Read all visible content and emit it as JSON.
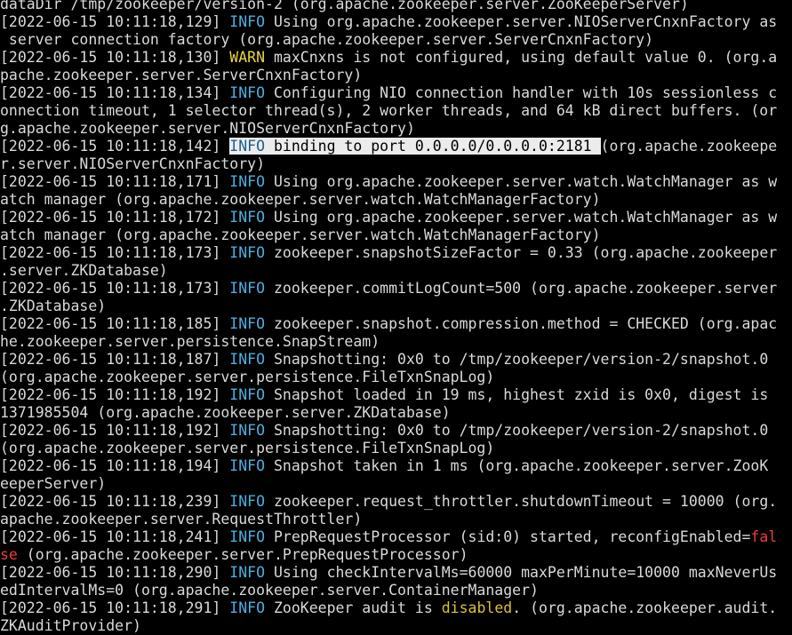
{
  "colors": {
    "background": "#000000",
    "text": "#d9d9d9",
    "info": "#49b0e0",
    "warn": "#e8d53a",
    "keyword_red": "#ef3b3b",
    "keyword_yellow": "#d6c332",
    "selection": "#ececec"
  },
  "terminal_lines": [
    [
      {
        "t": "dataDir /tmp/zookeeper/version-2 (org.apache.zookeeper.server.ZooKeeperServer)"
      }
    ],
    [
      {
        "t": "[2022-06-15 10:11:18,129] "
      },
      {
        "t": "INFO",
        "c": "level-info"
      },
      {
        "t": " Using org.apache.zookeeper.server.NIOServerCnxnFactory as"
      }
    ],
    [
      {
        "t": " server connection factory (org.apache.zookeeper.server.ServerCnxnFactory)"
      }
    ],
    [
      {
        "t": "[2022-06-15 10:11:18,130] "
      },
      {
        "t": "WARN",
        "c": "level-warn"
      },
      {
        "t": " maxCnxns is not configured, using default value 0. (org.a"
      }
    ],
    [
      {
        "t": "pache.zookeeper.server.ServerCnxnFactory)"
      }
    ],
    [
      {
        "t": "[2022-06-15 10:11:18,134] "
      },
      {
        "t": "INFO",
        "c": "level-info"
      },
      {
        "t": " Configuring NIO connection handler with 10s sessionless c"
      }
    ],
    [
      {
        "t": "onnection timeout, 1 selector thread(s), 2 worker threads, and 64 kB direct buffers. (or"
      }
    ],
    [
      {
        "t": "g.apache.zookeeper.server.NIOServerCnxnFactory)"
      }
    ],
    [
      {
        "t": "[2022-06-15 10:11:18,142] "
      },
      {
        "t": "INFO",
        "c": "level-info selected"
      },
      {
        "t": " binding to port 0.0.0.0/0.0.0.0:2181 ",
        "c": "selected"
      },
      {
        "t": "(org.apache.zookeepe"
      }
    ],
    [
      {
        "t": "r.server.NIOServerCnxnFactory)"
      }
    ],
    [
      {
        "t": "[2022-06-15 10:11:18,171] "
      },
      {
        "t": "INFO",
        "c": "level-info"
      },
      {
        "t": " Using org.apache.zookeeper.server.watch.WatchManager as w"
      }
    ],
    [
      {
        "t": "atch manager (org.apache.zookeeper.server.watch.WatchManagerFactory)"
      }
    ],
    [
      {
        "t": "[2022-06-15 10:11:18,172] "
      },
      {
        "t": "INFO",
        "c": "level-info"
      },
      {
        "t": " Using org.apache.zookeeper.server.watch.WatchManager as w"
      }
    ],
    [
      {
        "t": "atch manager (org.apache.zookeeper.server.watch.WatchManagerFactory)"
      }
    ],
    [
      {
        "t": "[2022-06-15 10:11:18,173] "
      },
      {
        "t": "INFO",
        "c": "level-info"
      },
      {
        "t": " zookeeper.snapshotSizeFactor = 0.33 (org.apache.zookeeper"
      }
    ],
    [
      {
        "t": ".server.ZKDatabase)"
      }
    ],
    [
      {
        "t": "[2022-06-15 10:11:18,173] "
      },
      {
        "t": "INFO",
        "c": "level-info"
      },
      {
        "t": " zookeeper.commitLogCount=500 (org.apache.zookeeper.server"
      }
    ],
    [
      {
        "t": ".ZKDatabase)"
      }
    ],
    [
      {
        "t": "[2022-06-15 10:11:18,185] "
      },
      {
        "t": "INFO",
        "c": "level-info"
      },
      {
        "t": " zookeeper.snapshot.compression.method = CHECKED (org.apac"
      }
    ],
    [
      {
        "t": "he.zookeeper.server.persistence.SnapStream)"
      }
    ],
    [
      {
        "t": "[2022-06-15 10:11:18,187] "
      },
      {
        "t": "INFO",
        "c": "level-info"
      },
      {
        "t": " Snapshotting: 0x0 to /tmp/zookeeper/version-2/snapshot.0"
      }
    ],
    [
      {
        "t": "(org.apache.zookeeper.server.persistence.FileTxnSnapLog)"
      }
    ],
    [
      {
        "t": "[2022-06-15 10:11:18,192] "
      },
      {
        "t": "INFO",
        "c": "level-info"
      },
      {
        "t": " Snapshot loaded in 19 ms, highest zxid is 0x0, digest is"
      }
    ],
    [
      {
        "t": "1371985504 (org.apache.zookeeper.server.ZKDatabase)"
      }
    ],
    [
      {
        "t": "[2022-06-15 10:11:18,192] "
      },
      {
        "t": "INFO",
        "c": "level-info"
      },
      {
        "t": " Snapshotting: 0x0 to /tmp/zookeeper/version-2/snapshot.0"
      }
    ],
    [
      {
        "t": "(org.apache.zookeeper.server.persistence.FileTxnSnapLog)"
      }
    ],
    [
      {
        "t": "[2022-06-15 10:11:18,194] "
      },
      {
        "t": "INFO",
        "c": "level-info"
      },
      {
        "t": " Snapshot taken in 1 ms (org.apache.zookeeper.server.ZooK"
      }
    ],
    [
      {
        "t": "eeperServer)"
      }
    ],
    [
      {
        "t": "[2022-06-15 10:11:18,239] "
      },
      {
        "t": "INFO",
        "c": "level-info"
      },
      {
        "t": " zookeeper.request_throttler.shutdownTimeout = 10000 (org."
      }
    ],
    [
      {
        "t": "apache.zookeeper.server.RequestThrottler)"
      }
    ],
    [
      {
        "t": "[2022-06-15 10:11:18,241] "
      },
      {
        "t": "INFO",
        "c": "level-info"
      },
      {
        "t": " PrepRequestProcessor (sid:0) started, reconfigEnabled="
      },
      {
        "t": "fal",
        "c": "kw-red"
      }
    ],
    [
      {
        "t": "se",
        "c": "kw-red"
      },
      {
        "t": " (org.apache.zookeeper.server.PrepRequestProcessor)"
      }
    ],
    [
      {
        "t": "[2022-06-15 10:11:18,290] "
      },
      {
        "t": "INFO",
        "c": "level-info"
      },
      {
        "t": " Using checkIntervalMs=60000 maxPerMinute=10000 maxNeverUs"
      }
    ],
    [
      {
        "t": "edIntervalMs=0 (org.apache.zookeeper.server.ContainerManager)"
      }
    ],
    [
      {
        "t": "[2022-06-15 10:11:18,291] "
      },
      {
        "t": "INFO",
        "c": "level-info"
      },
      {
        "t": " ZooKeeper audit is "
      },
      {
        "t": "disabled",
        "c": "kw-yellow"
      },
      {
        "t": ". (org.apache.zookeeper.audit."
      }
    ],
    [
      {
        "t": "ZKAuditProvider)"
      }
    ]
  ]
}
